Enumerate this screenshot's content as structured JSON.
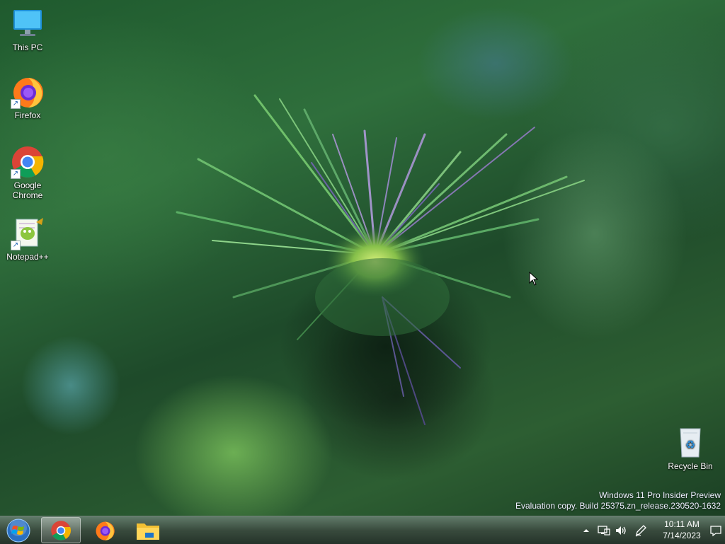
{
  "desktop": {
    "icons": [
      {
        "label": "This PC"
      },
      {
        "label": "Firefox"
      },
      {
        "label": "Google Chrome"
      },
      {
        "label": "Notepad++"
      },
      {
        "label": "Recycle Bin"
      }
    ],
    "watermark": {
      "line1": "Windows 11 Pro Insider Preview",
      "line2": "Evaluation copy. Build 25375.zn_release.230520-1632"
    }
  },
  "taskbar": {
    "start_icon": "windows-orb-icon",
    "pinned": [
      {
        "name": "chrome-icon",
        "active": true
      },
      {
        "name": "firefox-icon",
        "active": false
      },
      {
        "name": "file-explorer-icon",
        "active": false
      }
    ],
    "tray": {
      "icons": [
        "chevron-up-icon",
        "network-icon",
        "volume-icon",
        "pen-icon",
        "notification-icon"
      ],
      "time": "10:11 AM",
      "date": "7/14/2023"
    }
  },
  "colors": {
    "wallpaper_base": "#2f6f3c",
    "taskbar": "#28402e"
  }
}
